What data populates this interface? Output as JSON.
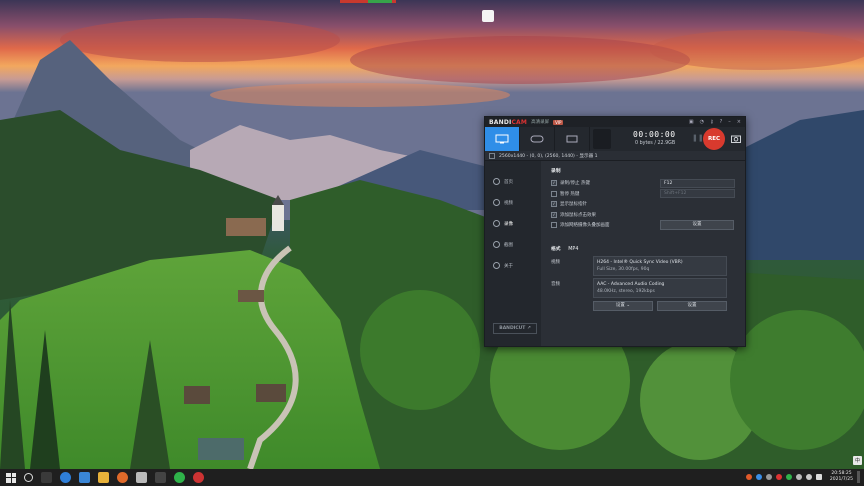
{
  "bandicam": {
    "logo_main": "BANDI",
    "logo_accent": "CAM",
    "subtitle": "高清录屏",
    "vip": "VIP",
    "timer": "00:00:00",
    "bytes": "0 bytes / 22.9GB",
    "rec_label": "REC",
    "area_text": "2560x1440 - (0, 0), (2560, 1440) - 显示器 1",
    "sidebar": [
      {
        "label": "首页"
      },
      {
        "label": "视频"
      },
      {
        "label": "录像"
      },
      {
        "label": "截图"
      },
      {
        "label": "关于"
      }
    ],
    "sidebar_logo": "BANDICUT ↗",
    "record": {
      "title": "录制",
      "options": [
        {
          "label": "录制/停止 热键",
          "checked": "✓",
          "value": "F12",
          "dim": false
        },
        {
          "label": "暂停 热键",
          "checked": "",
          "value": "Shift+F12",
          "dim": true
        },
        {
          "label": "显示鼠标指针",
          "checked": "✓",
          "value": "",
          "dim": false
        },
        {
          "label": "添加鼠标点击效果",
          "checked": "✓",
          "value": "",
          "dim": false
        },
        {
          "label": "添加网络摄像头叠加画面",
          "checked": "",
          "value": "",
          "dim": false
        }
      ],
      "settings_btn": "设置"
    },
    "format": {
      "title": "格式",
      "container": "MP4",
      "video_label": "视频",
      "video_line1": "H264 - Intel® Quick Sync Video (VBR)",
      "video_line2": "Full Size, 30.00fps, 90q",
      "audio_label": "音频",
      "audio_line1": "AAC - Advanced Audio Coding",
      "audio_line2": "48.0KHz, stereo, 192kbps",
      "preset_btn": "设置",
      "settings_btn": "设置"
    }
  },
  "taskbar": {
    "clock_time": "20:58:25",
    "clock_date": "2021/7/25",
    "ime": "中"
  },
  "colors": {
    "accent_blue": "#2f8ee8",
    "rec_red": "#d83a2e"
  }
}
